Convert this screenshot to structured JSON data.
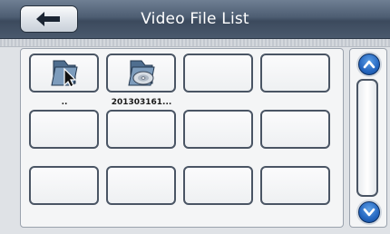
{
  "header": {
    "title": "Video File List",
    "back_icon": "left-arrow-icon"
  },
  "files": [
    {
      "label": "..",
      "icon": "folder-up-icon"
    },
    {
      "label": "201303161...",
      "icon": "video-disc-file-icon"
    },
    {
      "label": ""
    },
    {
      "label": ""
    },
    {
      "label": ""
    },
    {
      "label": ""
    },
    {
      "label": ""
    },
    {
      "label": ""
    },
    {
      "label": ""
    },
    {
      "label": ""
    },
    {
      "label": ""
    },
    {
      "label": ""
    }
  ],
  "scrollbar": {
    "up_icon": "chevron-up-icon",
    "down_icon": "chevron-down-icon"
  },
  "colors": {
    "header": "#4d5d72",
    "scroll_button": "#2466c0",
    "tile_border": "#4a5564"
  }
}
